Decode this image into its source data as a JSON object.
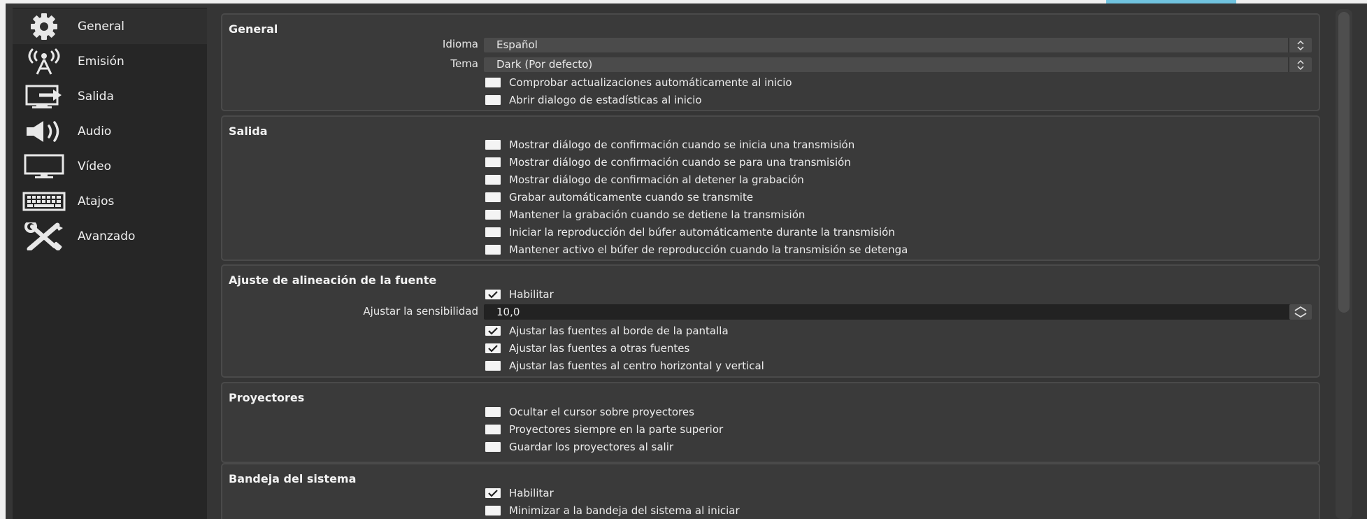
{
  "colors": {
    "window_bg": "#353535",
    "sidebar_bg": "#262626",
    "group_bg": "#3a3a3a",
    "accent": "#70c3df",
    "checkbox": "#f4f4f4"
  },
  "sidebar": {
    "items": [
      {
        "label": "General",
        "icon": "gear-icon",
        "active": true
      },
      {
        "label": "Emisión",
        "icon": "broadcast-antenna-icon",
        "active": false
      },
      {
        "label": "Salida",
        "icon": "output-monitor-icon",
        "active": false
      },
      {
        "label": "Audio",
        "icon": "speaker-icon",
        "active": false
      },
      {
        "label": "Vídeo",
        "icon": "monitor-icon",
        "active": false
      },
      {
        "label": "Atajos",
        "icon": "keyboard-icon",
        "active": false
      },
      {
        "label": "Avanzado",
        "icon": "tools-icon",
        "active": false
      }
    ]
  },
  "groups": {
    "general": {
      "title": "General",
      "language_label": "Idioma",
      "language_value": "Español",
      "theme_label": "Tema",
      "theme_value": "Dark (Por defecto)",
      "checks": [
        {
          "label": "Comprobar actualizaciones automáticamente al inicio",
          "checked": false
        },
        {
          "label": "Abrir dialogo de estadísticas al inicio",
          "checked": false
        }
      ]
    },
    "output": {
      "title": "Salida",
      "checks": [
        {
          "label": "Mostrar diálogo de confirmación cuando se inicia una transmisión",
          "checked": false
        },
        {
          "label": "Mostrar diálogo de confirmación cuando se para una transmisión",
          "checked": false
        },
        {
          "label": "Mostrar diálogo de confirmación al detener la grabación",
          "checked": false
        },
        {
          "label": "Grabar automáticamente cuando se transmite",
          "checked": false
        },
        {
          "label": "Mantener la grabación cuando se detiene la transmisión",
          "checked": false
        },
        {
          "label": "Iniciar la reproducción del búfer automáticamente durante la transmisión",
          "checked": false
        },
        {
          "label": "Mantener activo el búfer de reproducción cuando la transmisión se detenga",
          "checked": false
        }
      ]
    },
    "snapping": {
      "title": "Ajuste de alineación de la fuente",
      "enable": {
        "label": "Habilitar",
        "checked": true
      },
      "sensitivity_label": "Ajustar la sensibilidad",
      "sensitivity_value": "10,0",
      "checks": [
        {
          "label": "Ajustar las fuentes al borde de la pantalla",
          "checked": true
        },
        {
          "label": "Ajustar las fuentes a otras fuentes",
          "checked": true
        },
        {
          "label": "Ajustar las fuentes al centro horizontal y vertical",
          "checked": false
        }
      ]
    },
    "projectors": {
      "title": "Proyectores",
      "checks": [
        {
          "label": "Ocultar el cursor sobre proyectores",
          "checked": false
        },
        {
          "label": "Proyectores siempre en la parte superior",
          "checked": false
        },
        {
          "label": "Guardar los proyectores al salir",
          "checked": false
        }
      ]
    },
    "tray": {
      "title": "Bandeja del sistema",
      "checks": [
        {
          "label": "Habilitar",
          "checked": true
        },
        {
          "label": "Minimizar a la bandeja del sistema al iniciar",
          "checked": false
        }
      ]
    }
  }
}
